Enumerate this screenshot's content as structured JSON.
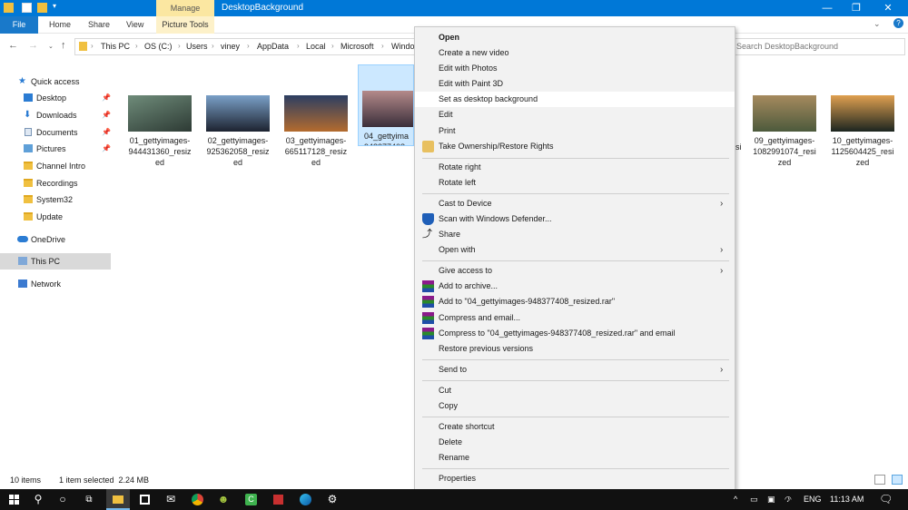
{
  "window": {
    "title": "DesktopBackground",
    "context_tab": "Manage",
    "minimize": "—",
    "maximize": "❐",
    "close": "✕"
  },
  "ribbon": {
    "file": "File",
    "tabs": [
      "Home",
      "Share",
      "View"
    ],
    "picture_tools": "Picture Tools"
  },
  "address_bar": {
    "crumbs": [
      "This PC",
      "OS (C:)",
      "Users",
      "viney",
      "AppData",
      "Local",
      "Microsoft",
      "Windo"
    ],
    "search_placeholder": "Search DesktopBackground"
  },
  "sidebar": {
    "quick_access": "Quick access",
    "items": [
      {
        "label": "Desktop",
        "pinned": true,
        "icon": "desktop-icon"
      },
      {
        "label": "Downloads",
        "pinned": true,
        "icon": "download-icon"
      },
      {
        "label": "Documents",
        "pinned": true,
        "icon": "documents-icon"
      },
      {
        "label": "Pictures",
        "pinned": true,
        "icon": "pictures-icon"
      },
      {
        "label": "Channel Intro",
        "pinned": false,
        "icon": "folder-icon"
      },
      {
        "label": "Recordings",
        "pinned": false,
        "icon": "folder-icon"
      },
      {
        "label": "System32",
        "pinned": false,
        "icon": "folder-icon"
      },
      {
        "label": "Update",
        "pinned": false,
        "icon": "folder-icon"
      }
    ],
    "onedrive": "OneDrive",
    "this_pc": "This PC",
    "network": "Network"
  },
  "files": [
    {
      "name": "01_gettyimages-944431360_resized",
      "lines": [
        "01_gettyimages-",
        "944431360_resiz",
        "ed"
      ],
      "colors": [
        "#6f8c7a",
        "#2d3a34"
      ]
    },
    {
      "name": "02_gettyimages-925362058_resized",
      "lines": [
        "02_gettyimages-",
        "925362058_resiz",
        "ed"
      ],
      "colors": [
        "#7aa0c8",
        "#1d2330"
      ]
    },
    {
      "name": "03_gettyimages-665117128_resized",
      "lines": [
        "03_gettyimages-",
        "665117128_resiz",
        "ed"
      ],
      "colors": [
        "#2c3e62",
        "#b46b2e"
      ]
    },
    {
      "name": "04_gettyimages-948377408_resized",
      "lines": [
        "04_gettyima",
        "948377408_r",
        "ed"
      ],
      "colors": [
        "#b48a8a",
        "#3a2e3a"
      ]
    },
    {
      "name": "09_gettyimages-1082991074_resized",
      "lines": [
        "09_gettyimages-",
        "1082991074_resi",
        "zed"
      ],
      "colors": [
        "#a68a5e",
        "#4c5a3c"
      ]
    },
    {
      "name": "10_gettyimages-1125604425_resized",
      "lines": [
        "10_gettyimages-",
        "1125604425_resi",
        "zed"
      ],
      "colors": [
        "#e0a050",
        "#1c2520"
      ]
    }
  ],
  "partial_label": "si",
  "status": {
    "count": "10 items",
    "selection": "1 item selected  2.24 MB"
  },
  "context_menu": {
    "items": [
      {
        "label": "Open",
        "bold": true
      },
      {
        "label": "Create a new video"
      },
      {
        "label": "Edit with Photos"
      },
      {
        "label": "Edit with Paint 3D"
      },
      {
        "label": "Set as desktop background",
        "highlighted": true
      },
      {
        "label": "Edit"
      },
      {
        "label": "Print"
      },
      {
        "label": "Take Ownership/Restore Rights",
        "icon": "ownership-icon"
      },
      {
        "label": "Rotate right"
      },
      {
        "label": "Rotate left"
      },
      {
        "label": "Cast to Device",
        "submenu": true
      },
      {
        "label": "Scan with Windows Defender...",
        "icon": "defender-icon"
      },
      {
        "label": "Share",
        "icon": "share-icon"
      },
      {
        "label": "Open with",
        "submenu": true
      },
      {
        "label": "Give access to",
        "submenu": true
      },
      {
        "label": "Add to archive...",
        "icon": "winrar-icon"
      },
      {
        "label": "Add to \"04_gettyimages-948377408_resized.rar\"",
        "icon": "winrar-icon"
      },
      {
        "label": "Compress and email...",
        "icon": "winrar-icon"
      },
      {
        "label": "Compress to \"04_gettyimages-948377408_resized.rar\" and email",
        "icon": "winrar-icon"
      },
      {
        "label": "Restore previous versions"
      },
      {
        "label": "Send to",
        "submenu": true
      },
      {
        "label": "Cut"
      },
      {
        "label": "Copy"
      },
      {
        "label": "Create shortcut"
      },
      {
        "label": "Delete"
      },
      {
        "label": "Rename"
      },
      {
        "label": "Properties"
      }
    ]
  },
  "taskbar": {
    "language": "ENG",
    "time": "11:13 AM"
  },
  "colors": {
    "accent": "#0078d7",
    "selection": "#cce8ff",
    "menu_bg": "#f2f2f2",
    "taskbar": "#111111"
  }
}
